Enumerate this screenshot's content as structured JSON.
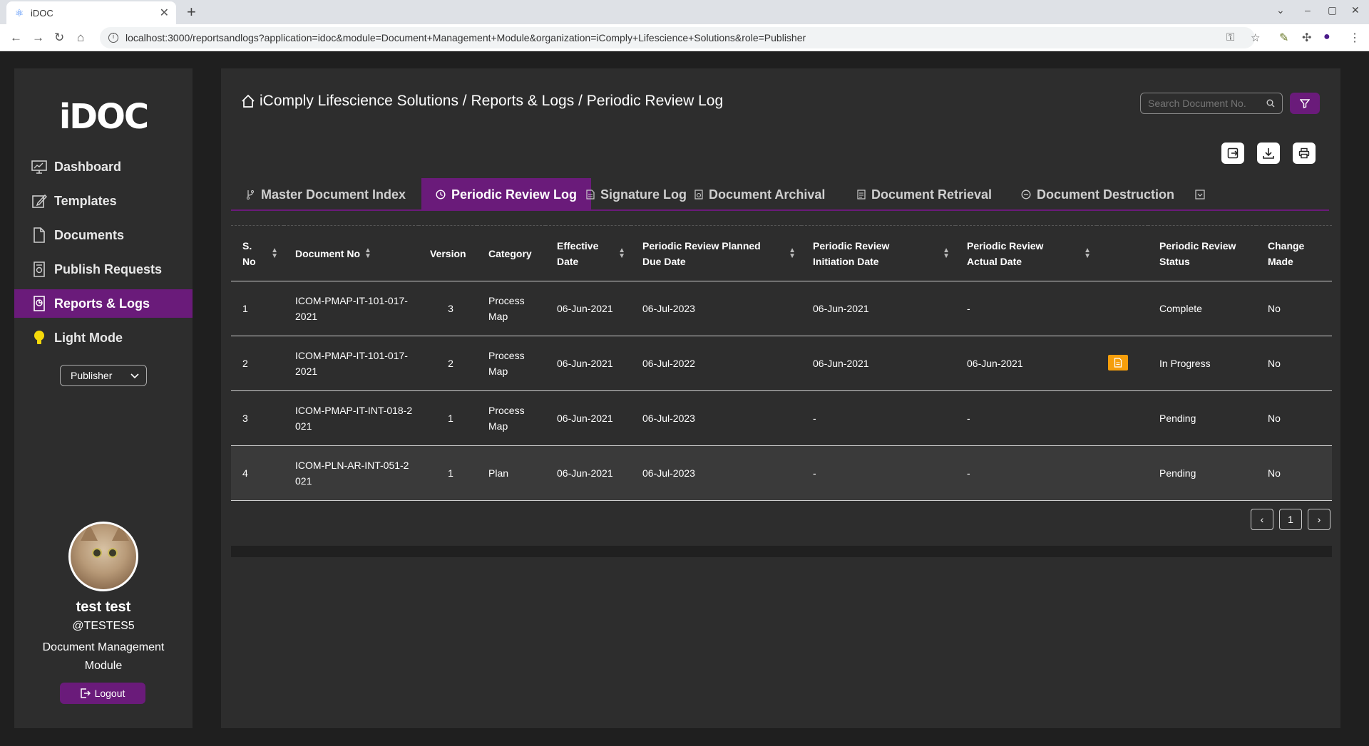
{
  "browser": {
    "tab_title": "iDOC",
    "url": "localhost:3000/reportsandlogs?application=idoc&module=Document+Management+Module&organization=iComply+Lifescience+Solutions&role=Publisher"
  },
  "sidebar": {
    "logo": "iDOC",
    "items": [
      {
        "label": "Dashboard",
        "icon": "monitor-icon"
      },
      {
        "label": "Templates",
        "icon": "edit-icon"
      },
      {
        "label": "Documents",
        "icon": "file-icon"
      },
      {
        "label": "Publish Requests",
        "icon": "publish-icon"
      },
      {
        "label": "Reports & Logs",
        "icon": "report-icon",
        "active": true
      },
      {
        "label": "Light Mode",
        "icon": "bulb-icon"
      }
    ],
    "role": "Publisher",
    "user": {
      "name": "test test",
      "handle": "@TESTES5",
      "module": "Document Management Module"
    },
    "logout_label": "Logout"
  },
  "header": {
    "breadcrumb": "iComply Lifescience Solutions / Reports & Logs / Periodic Review Log",
    "search_placeholder": "Search Document No."
  },
  "tabs": [
    {
      "label": "Master Document Index",
      "icon": "branch-icon"
    },
    {
      "label": "Periodic Review Log",
      "icon": "clock-icon",
      "active": true
    },
    {
      "label": "Signature Log",
      "icon": "doc-icon"
    },
    {
      "label": "Document Archival",
      "icon": "archive-icon"
    },
    {
      "label": "Document Retrieval",
      "icon": "retrieve-icon"
    },
    {
      "label": "Document Destruction",
      "icon": "minus-circle-icon"
    }
  ],
  "table": {
    "headers": {
      "sno": "S. No",
      "docno": "Document No",
      "version": "Version",
      "category": "Category",
      "effective": "Effective Date",
      "planned": "Periodic Review Planned Due Date",
      "initiation": "Periodic Review Initiation Date",
      "actual": "Periodic Review Actual Date",
      "status": "Periodic Review Status",
      "change": "Change Made"
    },
    "rows": [
      {
        "sno": "1",
        "docno": "ICOM-PMAP-IT-101-017-2021",
        "version": "3",
        "category": "Process Map",
        "effective": "06-Jun-2021",
        "planned": "06-Jul-2023",
        "initiation": "06-Jun-2021",
        "actual": "-",
        "status": "Complete",
        "change": "No"
      },
      {
        "sno": "2",
        "docno": "ICOM-PMAP-IT-101-017-2021",
        "version": "2",
        "category": "Process Map",
        "effective": "06-Jun-2021",
        "planned": "06-Jul-2022",
        "initiation": "06-Jun-2021",
        "actual": "06-Jun-2021",
        "status": "In Progress",
        "change": "No"
      },
      {
        "sno": "3",
        "docno": "ICOM-PMAP-IT-INT-018-2021",
        "version": "1",
        "category": "Process Map",
        "effective": "06-Jun-2021",
        "planned": "06-Jul-2023",
        "initiation": "-",
        "actual": "-",
        "status": "Pending",
        "change": "No"
      },
      {
        "sno": "4",
        "docno": "ICOM-PLN-AR-INT-051-2021",
        "version": "1",
        "category": "Plan",
        "effective": "06-Jun-2021",
        "planned": "06-Jul-2023",
        "initiation": "-",
        "actual": "-",
        "status": "Pending",
        "change": "No"
      }
    ]
  },
  "pagination": {
    "current": "1"
  },
  "colors": {
    "accent": "#6a1b7a",
    "panel": "#2d2d2d",
    "background": "#1f1f1f",
    "doc_badge": "#f59e0b"
  }
}
